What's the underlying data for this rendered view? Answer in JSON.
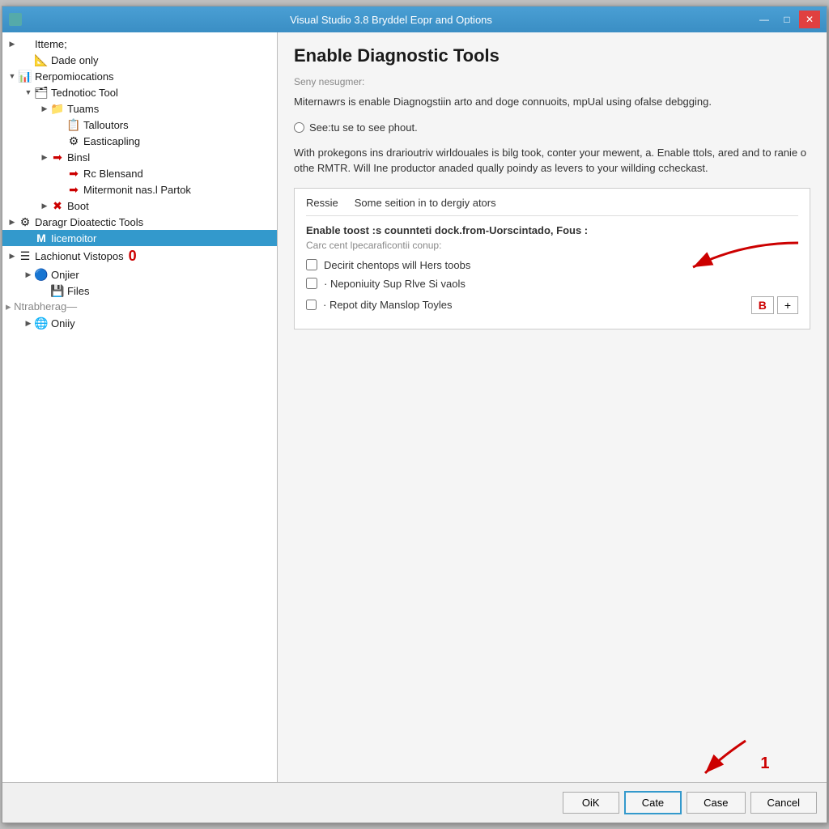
{
  "window": {
    "title": "Visual Studio 3.8 Bryddel Eopr and Options",
    "icon": "vs-icon",
    "close_btn": "✕",
    "min_btn": "—",
    "max_btn": "□"
  },
  "tree": {
    "items": [
      {
        "id": "items",
        "label": "Itteme;",
        "indent": 0,
        "expand": "▶",
        "icon": "",
        "selected": false
      },
      {
        "id": "dade-only",
        "label": "Dade only",
        "indent": 1,
        "expand": "",
        "icon": "📐",
        "selected": false
      },
      {
        "id": "repomications",
        "label": "Rerpomiocations",
        "indent": 0,
        "expand": "▼",
        "icon": "📊",
        "selected": false
      },
      {
        "id": "tednotioc-tool",
        "label": "Tednotioc Tool",
        "indent": 1,
        "expand": "▼",
        "icon": "🗂",
        "selected": false
      },
      {
        "id": "tuams",
        "label": "Tuams",
        "indent": 2,
        "expand": "▶",
        "icon": "📁",
        "selected": false
      },
      {
        "id": "talloutors",
        "label": "Talloutors",
        "indent": 3,
        "expand": "",
        "icon": "📋",
        "selected": false
      },
      {
        "id": "easticapling",
        "label": "Easticapling",
        "indent": 3,
        "expand": "",
        "icon": "⚙",
        "selected": false
      },
      {
        "id": "binsl",
        "label": "Binsl",
        "indent": 3,
        "expand": "▶",
        "icon": "➡",
        "selected": false
      },
      {
        "id": "rc-blensand",
        "label": "Rc Blensand",
        "indent": 4,
        "expand": "",
        "icon": "➡",
        "selected": false
      },
      {
        "id": "mitermonit",
        "label": "Mitermonit nas.l Partok",
        "indent": 4,
        "expand": "",
        "icon": "➡",
        "selected": false
      },
      {
        "id": "boot",
        "label": "Boot",
        "indent": 2,
        "expand": "▶",
        "icon": "✖",
        "selected": false
      },
      {
        "id": "daragr-diagnostic",
        "label": "Daragr Dioatectic Tools",
        "indent": 0,
        "expand": "▶",
        "icon": "⚙",
        "selected": false
      },
      {
        "id": "iicemoitor",
        "label": "Iicemoitor",
        "indent": 1,
        "expand": "",
        "icon": "M",
        "selected": true
      },
      {
        "id": "lachionut",
        "label": "Lachionut Vistopos",
        "indent": 0,
        "expand": "▶",
        "icon": "☰",
        "selected": false,
        "badge": "0"
      },
      {
        "id": "onjier",
        "label": "Onjier",
        "indent": 1,
        "expand": "▶",
        "icon": "🔵",
        "selected": false
      },
      {
        "id": "files",
        "label": "Files",
        "indent": 2,
        "expand": "",
        "icon": "💾",
        "selected": false
      },
      {
        "id": "ntrabherag",
        "label": "▸ Ntrabherag—",
        "indent": 0,
        "expand": "",
        "icon": "",
        "selected": false
      },
      {
        "id": "oniiy",
        "label": "Oniiy",
        "indent": 1,
        "expand": "▶",
        "icon": "🌐",
        "selected": false
      }
    ]
  },
  "right": {
    "title": "Enable Diagnostic Tools",
    "section_label": "Seny nesugmer:",
    "description1": "Miternawrs is enable Diagnogstiin arto and doge connuoits, mpUal using ofalse debgging.",
    "radio_label": "See:tu se to see phout.",
    "description2": "With prokegons ins drarioutriv wirldouales is bilg took, conter your mewent, a. Enable ttols, ared and to ranie o othe RMTR. Will Ine productor anaded qually poindy as levers to your willding ccheckast.",
    "options_tabs": [
      {
        "id": "ressie",
        "label": "Ressie"
      },
      {
        "id": "some-seition",
        "label": "Some seition in to dergiy ators"
      }
    ],
    "field_label": "Enable toost :s counnteti dock.from-Uorscintado, Fous :",
    "field_sub": "Carc cent lpecaraficontii conup:",
    "checkboxes": [
      {
        "id": "cb1",
        "label": "Decirit chentops will Hers toobs",
        "checked": false
      },
      {
        "id": "cb2",
        "label": "· Neponiuity Sup Rlve Si vaols",
        "checked": false
      },
      {
        "id": "cb3",
        "label": "· Repot dity Manslop Toyles",
        "checked": false
      }
    ],
    "btn_b": "B",
    "btn_plus": "+"
  },
  "bottom_bar": {
    "ok_label": "OiK",
    "cate_label": "Cate",
    "case_label": "Case",
    "cancel_label": "Cancel",
    "annotation_num": "1"
  }
}
